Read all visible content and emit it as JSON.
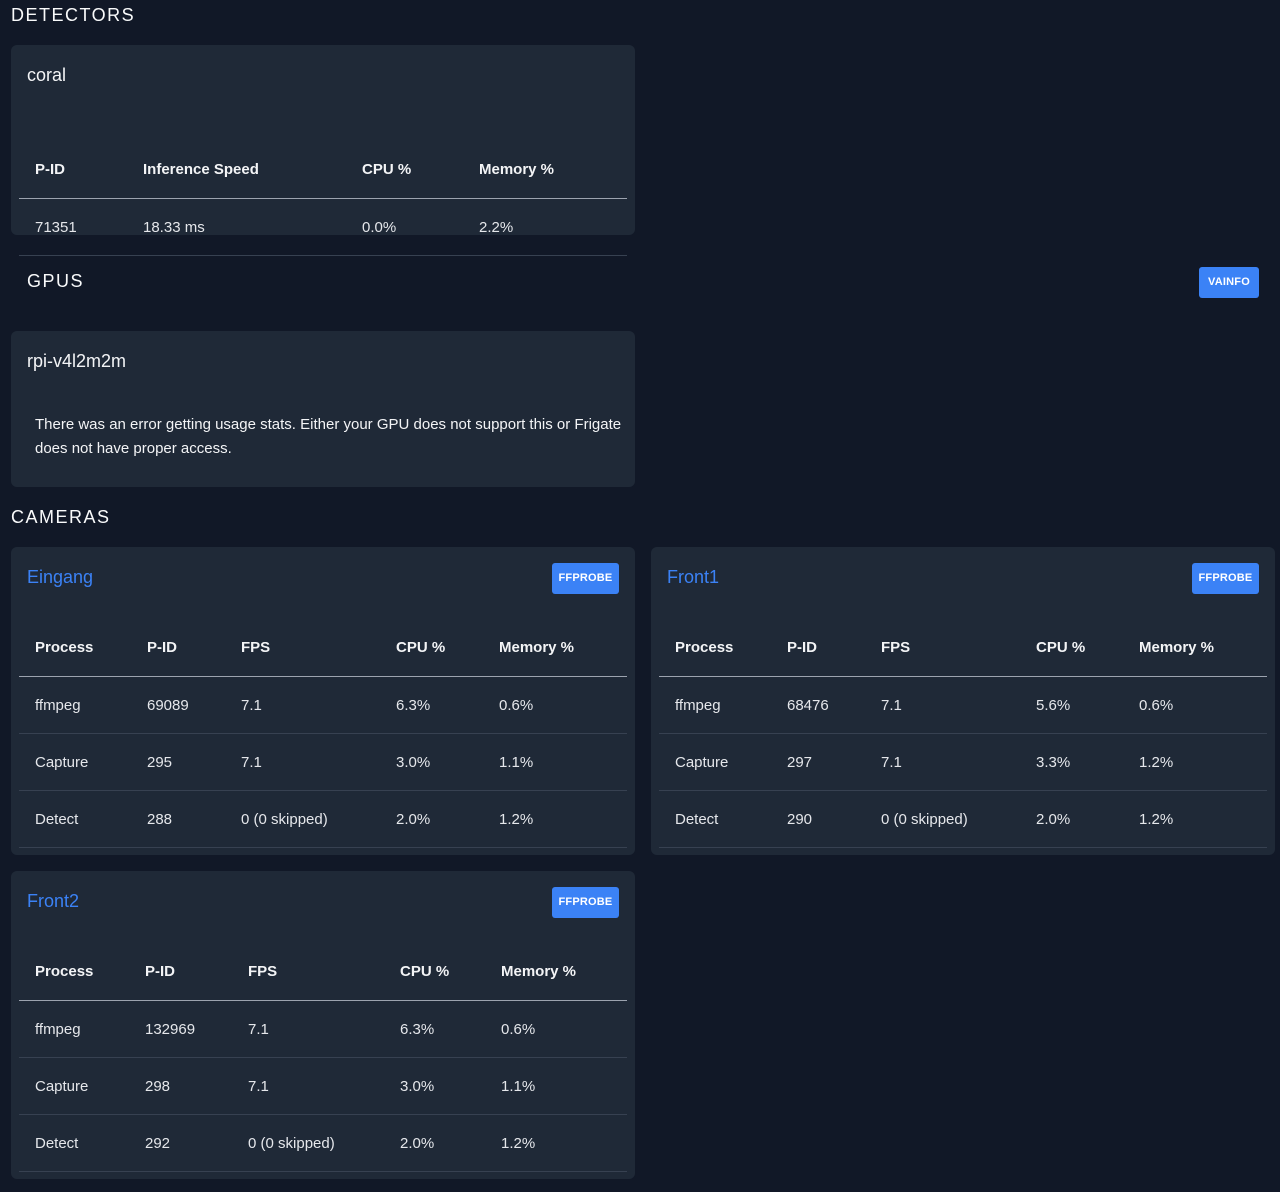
{
  "sections": {
    "detectors": "DETECTORS",
    "gpus": "GPUS",
    "cameras": "CAMERAS"
  },
  "detector": {
    "name": "coral",
    "headers": [
      "P-ID",
      "Inference Speed",
      "CPU %",
      "Memory %"
    ],
    "rows": [
      [
        "71351",
        "18.33 ms",
        "0.0%",
        "2.2%"
      ]
    ]
  },
  "gpu": {
    "vainfo_label": "VAINFO",
    "name": "rpi-v4l2m2m",
    "error": "There was an error getting usage stats. Either your GPU does not support this or Frigate does not have proper access."
  },
  "cameras": [
    {
      "name": "Eingang",
      "button": "FFPROBE",
      "headers": [
        "Process",
        "P-ID",
        "FPS",
        "CPU %",
        "Memory %"
      ],
      "rows": [
        [
          "ffmpeg",
          "69089",
          "7.1",
          "6.3%",
          "0.6%"
        ],
        [
          "Capture",
          "295",
          "7.1",
          "3.0%",
          "1.1%"
        ],
        [
          "Detect",
          "288",
          "0 (0 skipped)",
          "2.0%",
          "1.2%"
        ]
      ]
    },
    {
      "name": "Front1",
      "button": "FFPROBE",
      "headers": [
        "Process",
        "P-ID",
        "FPS",
        "CPU %",
        "Memory %"
      ],
      "rows": [
        [
          "ffmpeg",
          "68476",
          "7.1",
          "5.6%",
          "0.6%"
        ],
        [
          "Capture",
          "297",
          "7.1",
          "3.3%",
          "1.2%"
        ],
        [
          "Detect",
          "290",
          "0 (0 skipped)",
          "2.0%",
          "1.2%"
        ]
      ]
    },
    {
      "name": "Front2",
      "button": "FFPROBE",
      "headers": [
        "Process",
        "P-ID",
        "FPS",
        "CPU %",
        "Memory %"
      ],
      "rows": [
        [
          "ffmpeg",
          "132969",
          "7.1",
          "6.3%",
          "0.6%"
        ],
        [
          "Capture",
          "298",
          "7.1",
          "3.0%",
          "1.1%"
        ],
        [
          "Detect",
          "292",
          "0 (0 skipped)",
          "2.0%",
          "1.2%"
        ]
      ]
    }
  ]
}
